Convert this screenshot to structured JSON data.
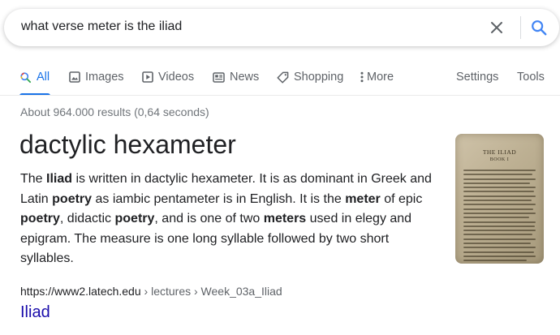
{
  "search": {
    "query": "what verse meter is the iliad"
  },
  "tabs": {
    "items": [
      {
        "label": "All"
      },
      {
        "label": "Images"
      },
      {
        "label": "Videos"
      },
      {
        "label": "News"
      },
      {
        "label": "Shopping"
      },
      {
        "label": "More"
      }
    ],
    "settings": "Settings",
    "tools": "Tools"
  },
  "stats": "About 964.000 results (0,64 seconds)",
  "answer": {
    "title": "dactylic hexameter",
    "snippet": [
      {
        "text": "The ",
        "bold": false
      },
      {
        "text": "Iliad",
        "bold": true
      },
      {
        "text": " is written in dactylic hexameter. It is as dominant in Greek and Latin ",
        "bold": false
      },
      {
        "text": "poetry",
        "bold": true
      },
      {
        "text": " as iambic pentameter is in English. It is the ",
        "bold": false
      },
      {
        "text": "meter",
        "bold": true
      },
      {
        "text": " of epic ",
        "bold": false
      },
      {
        "text": "poetry",
        "bold": true
      },
      {
        "text": ", didactic ",
        "bold": false
      },
      {
        "text": "poetry",
        "bold": true
      },
      {
        "text": ", and is one of two ",
        "bold": false
      },
      {
        "text": "meters",
        "bold": true
      },
      {
        "text": " used in elegy and epigram. The measure is one long syllable followed by two short syllables.",
        "bold": false
      }
    ],
    "image": {
      "heading": "THE ILIAD",
      "subheading": "BOOK I"
    }
  },
  "source": {
    "domain": "https://www2.latech.edu",
    "path": " › lectures › Week_03a_Iliad",
    "title": "Iliad"
  },
  "colors": {
    "accent": "#1a73e8",
    "link": "#1a0dab",
    "muted": "#5f6368"
  },
  "icons": {
    "clear": "close-icon",
    "search": "search-icon",
    "tabs": [
      "search-icon",
      "image-icon",
      "video-icon",
      "newspaper-icon",
      "tag-icon",
      "more-vert-icon"
    ]
  }
}
